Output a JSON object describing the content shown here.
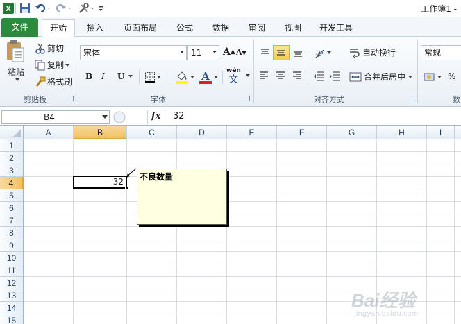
{
  "window": {
    "title": "工作簿1 -"
  },
  "tabs": [
    {
      "label": "文件"
    },
    {
      "label": "开始"
    },
    {
      "label": "插入"
    },
    {
      "label": "页面布局"
    },
    {
      "label": "公式"
    },
    {
      "label": "数据"
    },
    {
      "label": "审阅"
    },
    {
      "label": "视图"
    },
    {
      "label": "开发工具"
    }
  ],
  "ribbon": {
    "clipboard": {
      "group_label": "剪贴板",
      "paste": "粘贴",
      "cut": "剪切",
      "copy": "复制",
      "format_painter": "格式刷"
    },
    "font": {
      "group_label": "字体",
      "font_name": "宋体",
      "font_size": "11",
      "bold": "B",
      "italic": "I",
      "underline": "U",
      "grow": "A",
      "shrink": "A",
      "font_color_glyph": "A",
      "phonetic_glyph": "wén",
      "phonetic_char": "文"
    },
    "alignment": {
      "group_label": "对齐方式",
      "wrap_text": "自动换行",
      "merge_center": "合并后居中"
    },
    "number": {
      "group_label": "数",
      "format": "常规",
      "percent": "%"
    }
  },
  "formula_bar": {
    "name_box": "B4",
    "fx": "fx",
    "value": "32"
  },
  "sheet": {
    "columns": [
      "A",
      "B",
      "C",
      "D",
      "E",
      "F",
      "G",
      "H",
      "I"
    ],
    "rows": [
      "1",
      "2",
      "3",
      "4",
      "5",
      "6",
      "7",
      "8",
      "9",
      "10",
      "11",
      "12",
      "13",
      "14",
      "15"
    ],
    "active_col": "B",
    "active_row": "4",
    "active_cell_value": "32",
    "comment_text": "不良数量"
  },
  "watermark": {
    "brand": "Bai经验",
    "url": "jingyan.baidu.com"
  },
  "colors": {
    "file_tab": "#2c8a3c",
    "selection_header": "#f1c15f",
    "comment_bg": "#ffffe1"
  }
}
